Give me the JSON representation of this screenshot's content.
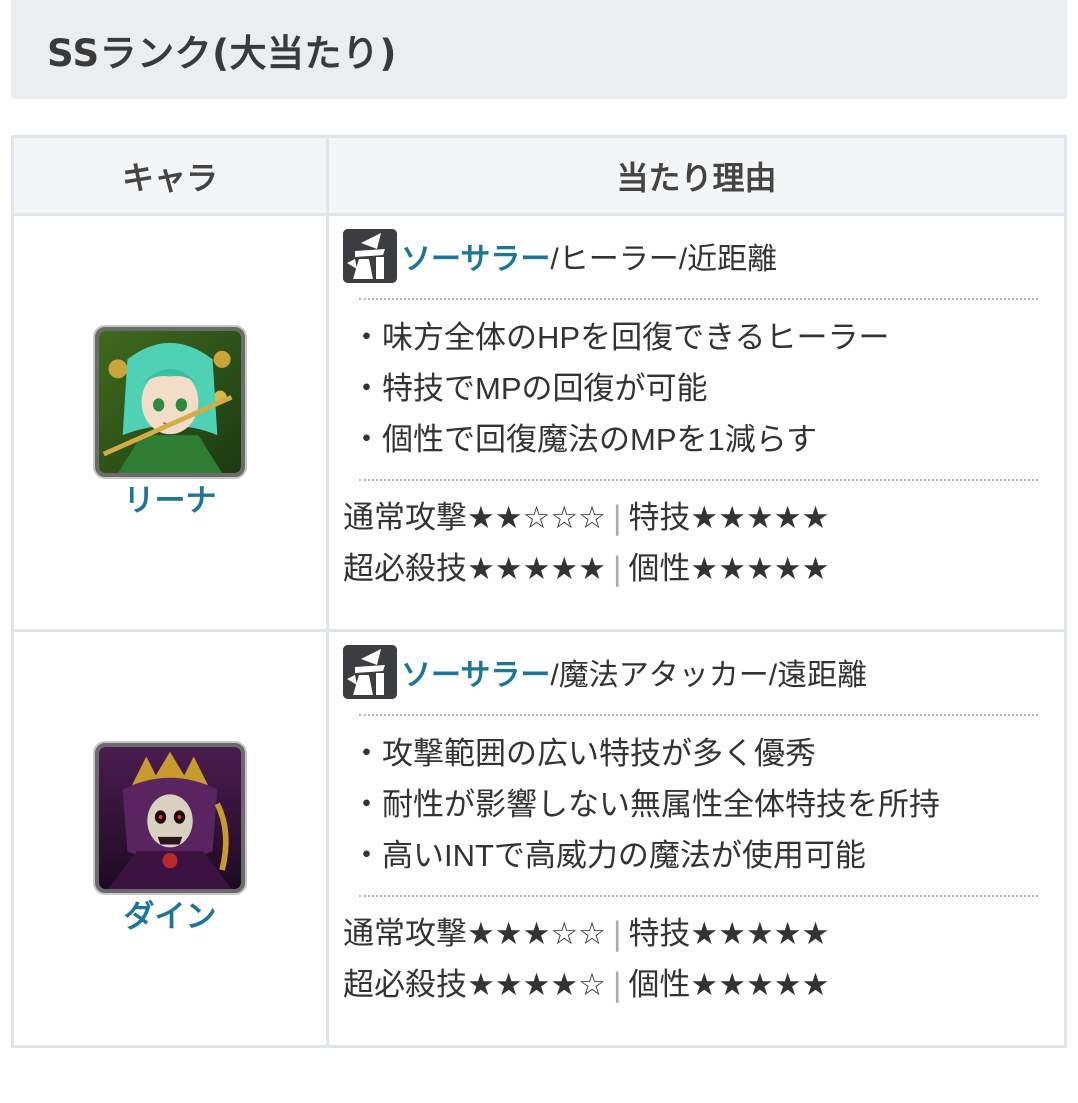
{
  "section": {
    "title": "SSランク(大当たり)"
  },
  "table": {
    "headers": {
      "chara": "キャラ",
      "reason": "当たり理由"
    },
    "rows": [
      {
        "name": "リーナ",
        "role_link": "ソーサラー",
        "role_rest": "/ヒーラー/近距離",
        "points": [
          "味方全体のHPを回復できるヒーラー",
          "特技でMPの回復が可能",
          "個性で回復魔法のMPを1減らす"
        ],
        "stats_line1": {
          "left": "通常攻撃★★☆☆☆",
          "sep": "|",
          "right": "特技★★★★★"
        },
        "stats_line2": {
          "left": "超必殺技★★★★★",
          "sep": "|",
          "right": "個性★★★★★"
        },
        "ratings": {
          "通常攻撃": 2,
          "特技": 5,
          "超必殺技": 5,
          "個性": 5
        },
        "avatar_icon": "green-haired-healer-portrait"
      },
      {
        "name": "ダイン",
        "role_link": "ソーサラー",
        "role_rest": "/魔法アタッカー/遠距離",
        "points": [
          "攻撃範囲の広い特技が多く優秀",
          "耐性が影響しない無属性全体特技を所持",
          "高いINTで高威力の魔法が使用可能"
        ],
        "stats_line1": {
          "left": "通常攻撃★★★☆☆",
          "sep": "|",
          "right": "特技★★★★★"
        },
        "stats_line2": {
          "left": "超必殺技★★★★☆",
          "sep": "|",
          "right": "個性★★★★★"
        },
        "ratings": {
          "通常攻撃": 3,
          "特技": 5,
          "超必殺技": 4,
          "個性": 5
        },
        "avatar_icon": "skull-sorcerer-portrait"
      }
    ]
  },
  "colors": {
    "link": "#1d7698",
    "heading_bg": "#ebeef0",
    "border": "#dfe5e8"
  },
  "icons": {
    "role": "sorcerer-class-icon"
  }
}
